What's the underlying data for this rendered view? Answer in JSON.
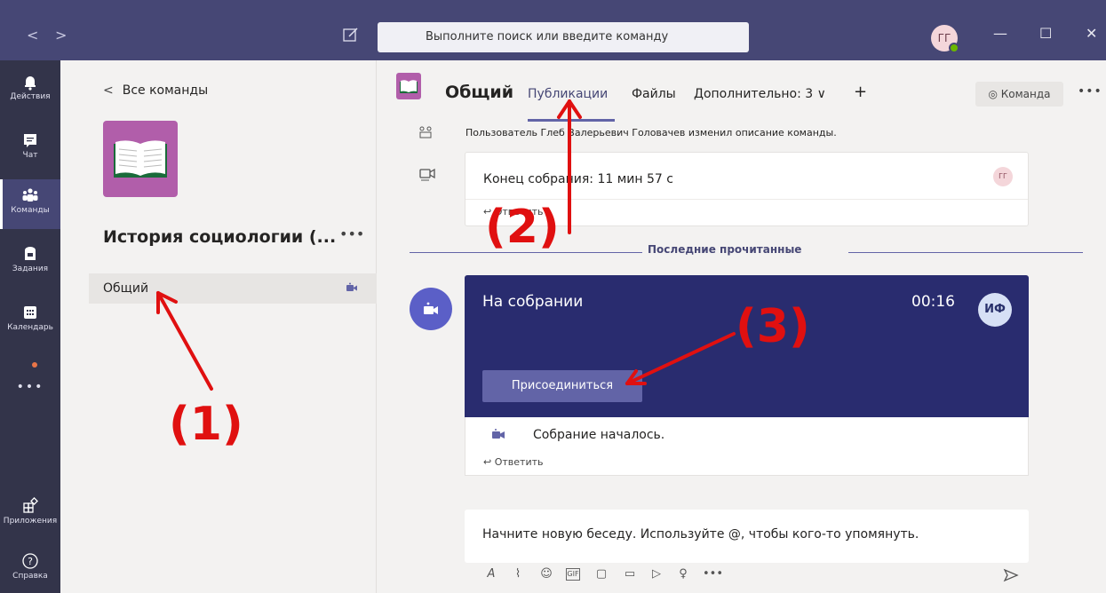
{
  "titlebar": {
    "back_arrow": "<",
    "forward_arrow": ">",
    "search_placeholder": "Выполните поиск или введите команду",
    "user_initials": "ГГ",
    "minimize": "—",
    "maximize": "☐",
    "close": "✕"
  },
  "rail": {
    "items": [
      {
        "label": "Действия",
        "icon": "bell-icon"
      },
      {
        "label": "Чат",
        "icon": "chat-icon"
      },
      {
        "label": "Команды",
        "icon": "teams-icon"
      },
      {
        "label": "Задания",
        "icon": "assignments-icon"
      },
      {
        "label": "Календарь",
        "icon": "calendar-icon"
      }
    ],
    "more": "•••",
    "apps_label": "Приложения",
    "help_label": "Справка"
  },
  "panel": {
    "back_label": "Все команды",
    "team_name": "История социологии (...",
    "team_more": "•••",
    "channel": "Общий"
  },
  "header": {
    "channel_title": "Общий",
    "tabs": [
      "Публикации",
      "Файлы",
      "Дополнительно: 3 ∨",
      "+"
    ],
    "team_button": "◎ Команда",
    "more": "•••"
  },
  "feed": {
    "system_message": "Пользователь Глеб Валерьевич Головачев изменил описание команды.",
    "meeting_end": "Конец собрания: 11 мин 57 с",
    "meeting_end_avatar": "ГГ",
    "reply_label": "↩ Ответить",
    "last_read": "Последние прочитанные",
    "meeting_title": "На собрании",
    "meeting_time": "00:16",
    "meeting_avatar": "ИФ",
    "join_button": "Присоединиться",
    "meeting_started": "Собрание началось."
  },
  "compose": {
    "placeholder": "Начните новую беседу. Используйте @, чтобы кого-то упомянуть."
  },
  "annotations": {
    "label1": "(1)",
    "label2": "(2)",
    "label3": "(3)"
  },
  "colors": {
    "titlebar": "#464775",
    "rail": "#33344a",
    "accent": "#6264a7",
    "meeting_card": "#292c6f",
    "team_logo": "#b15eaa",
    "annotation": "#e01010"
  }
}
